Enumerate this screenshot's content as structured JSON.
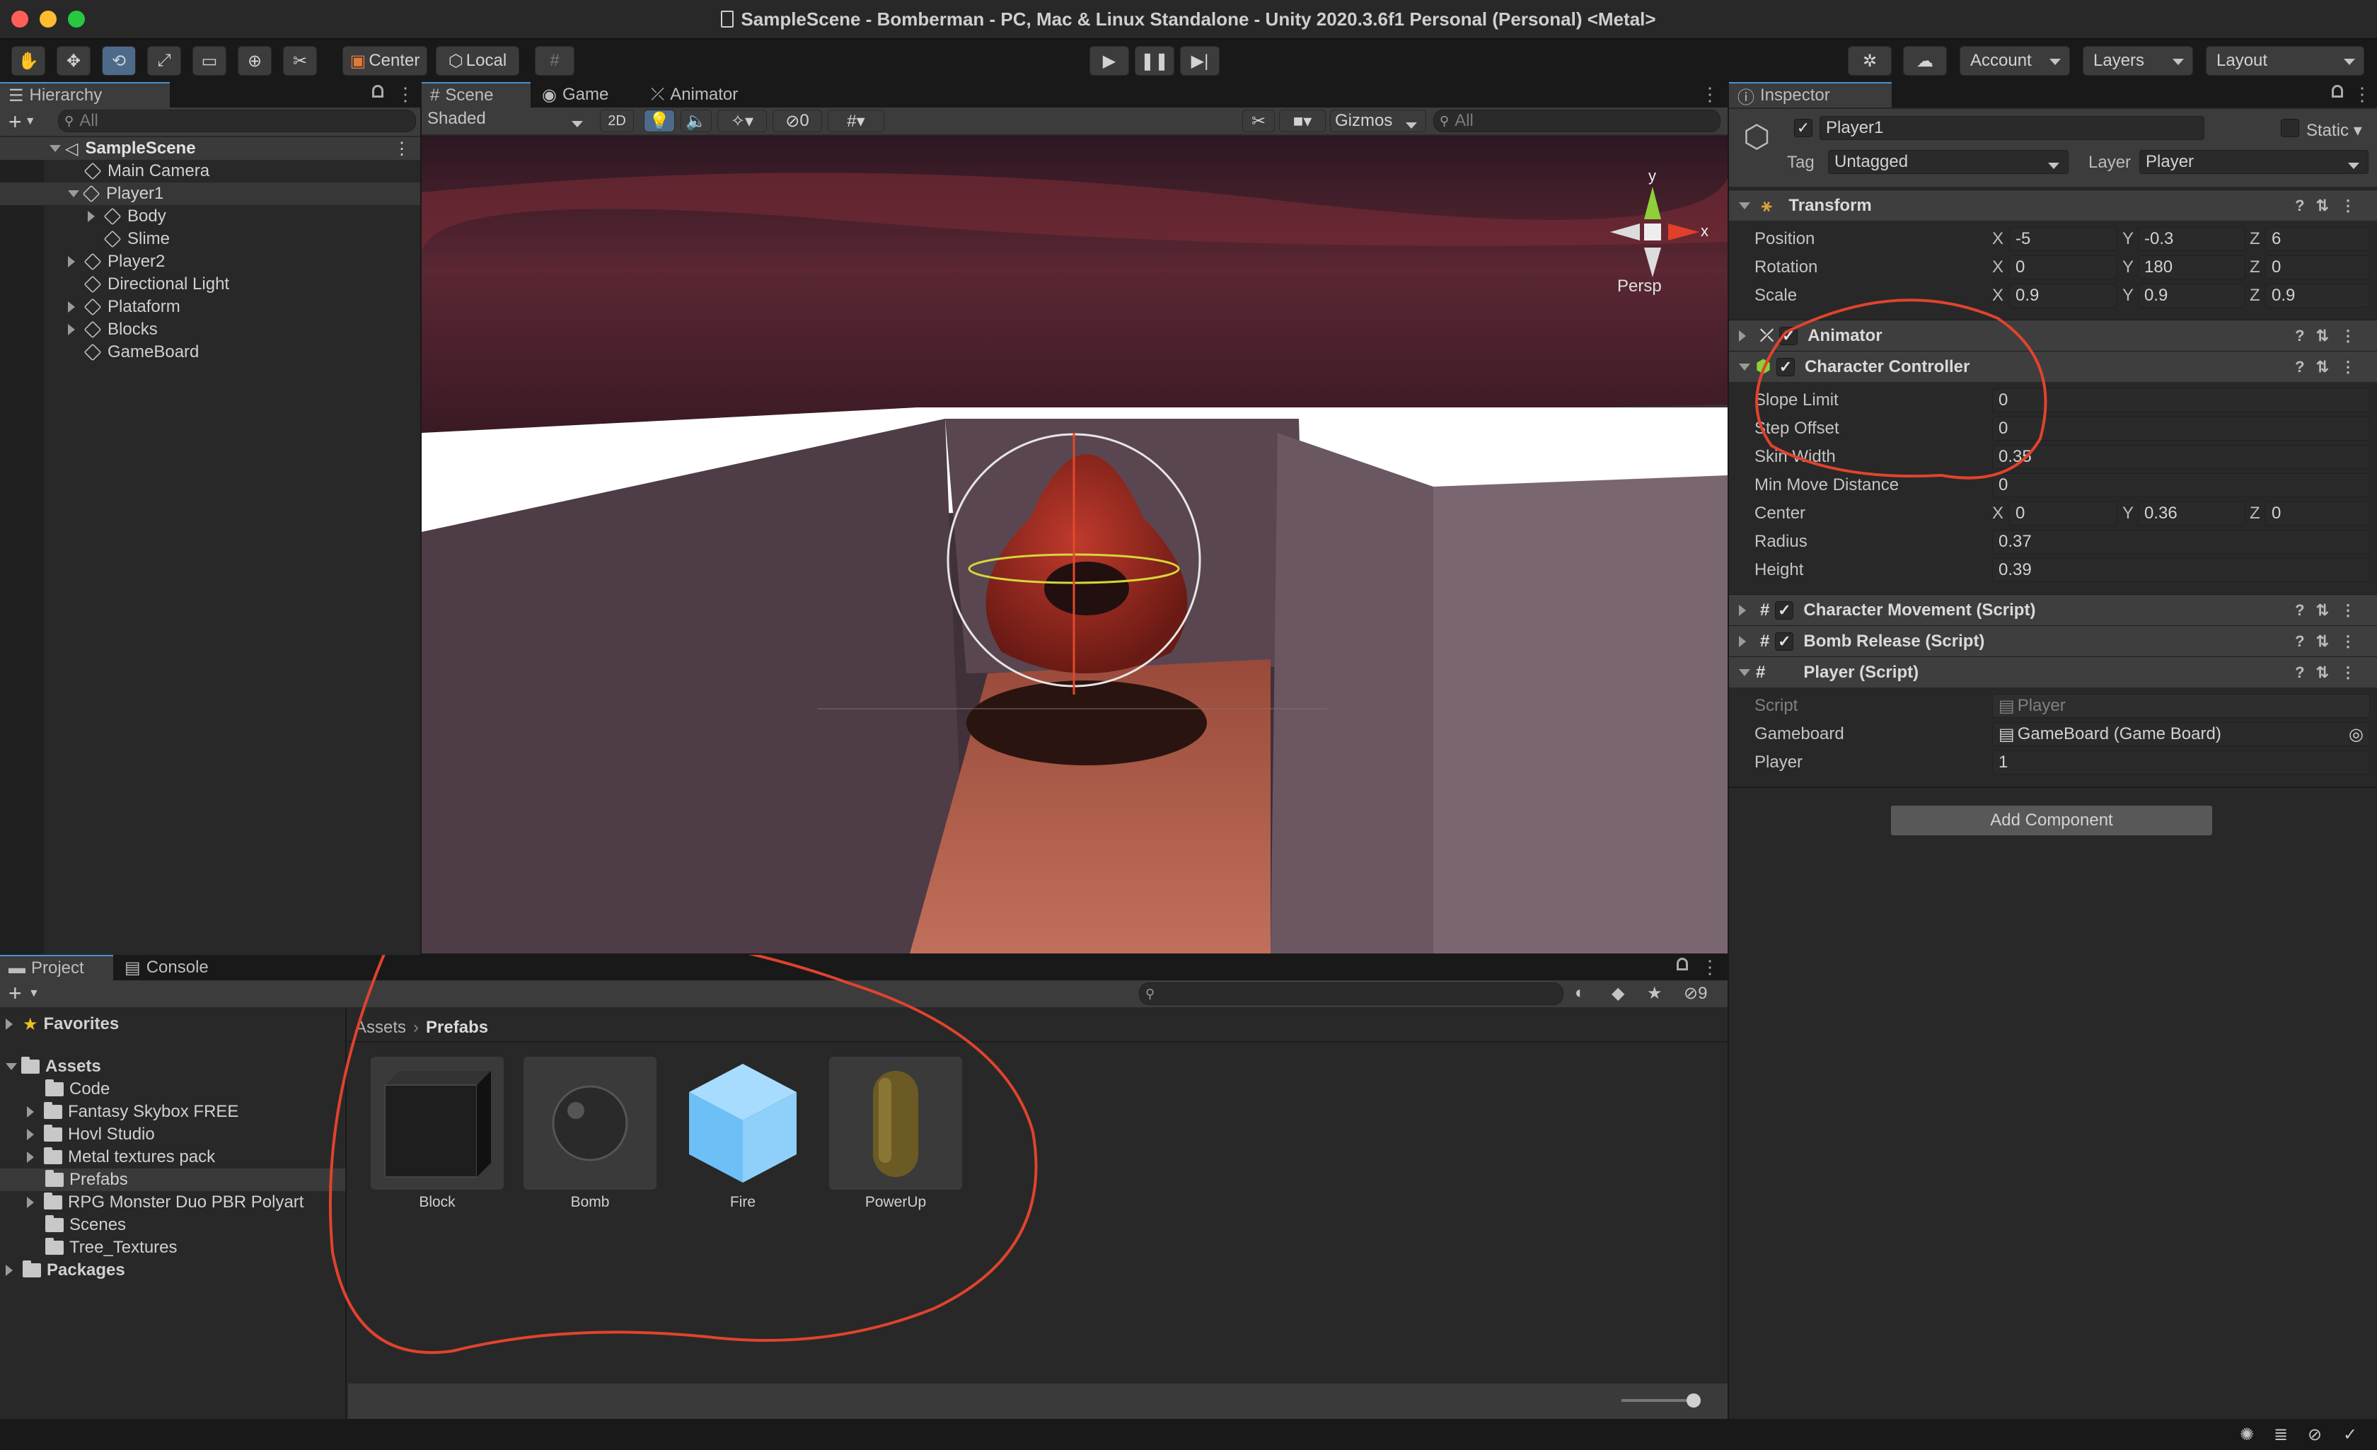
{
  "window": {
    "title": "SampleScene - Bomberman - PC, Mac & Linux Standalone - Unity 2020.3.6f1 Personal (Personal) <Metal>"
  },
  "toolbar": {
    "center_label": "Center",
    "local_label": "Local",
    "account_label": "Account",
    "layers_label": "Layers",
    "layout_label": "Layout"
  },
  "hierarchy": {
    "tab_label": "Hierarchy",
    "search_placeholder": "All",
    "scene": "SampleScene",
    "items": [
      "Main Camera",
      "Player1",
      "Body",
      "Slime",
      "Player2",
      "Directional Light",
      "Plataform",
      "Blocks",
      "GameBoard"
    ]
  },
  "scene_view": {
    "tabs": [
      "Scene",
      "Game",
      "Animator"
    ],
    "shading_mode": "Shaded",
    "mode_2d": "2D",
    "hidden_count": "0",
    "gizmos_label": "Gizmos",
    "search_placeholder": "All",
    "gizmo_axis_y": "y",
    "gizmo_axis_x": "x",
    "projection": "Persp"
  },
  "inspector": {
    "tab_label": "Inspector",
    "object_name": "Player1",
    "static_label": "Static",
    "tag_label": "Tag",
    "tag_value": "Untagged",
    "layer_label": "Layer",
    "layer_value": "Player",
    "transform": {
      "title": "Transform",
      "position_label": "Position",
      "rotation_label": "Rotation",
      "scale_label": "Scale",
      "axis_x": "X",
      "axis_y": "Y",
      "axis_z": "Z",
      "position": {
        "x": "-5",
        "y": "-0.3",
        "z": "6"
      },
      "rotation": {
        "x": "0",
        "y": "180",
        "z": "0"
      },
      "scale": {
        "x": "0.9",
        "y": "0.9",
        "z": "0.9"
      }
    },
    "animator": {
      "title": "Animator"
    },
    "character_controller": {
      "title": "Character Controller",
      "slope_limit_label": "Slope Limit",
      "slope_limit": "0",
      "step_offset_label": "Step Offset",
      "step_offset": "0",
      "skin_width_label": "Skin Width",
      "skin_width": "0.35",
      "min_move_label": "Min Move Distance",
      "min_move": "0",
      "center_label": "Center",
      "center": {
        "x": "0",
        "y": "0.36",
        "z": "0"
      },
      "radius_label": "Radius",
      "radius": "0.37",
      "height_label": "Height",
      "height": "0.39"
    },
    "character_movement": {
      "title": "Character Movement (Script)"
    },
    "bomb_release": {
      "title": "Bomb Release (Script)"
    },
    "player_script": {
      "title": "Player (Script)",
      "script_label": "Script",
      "script_value": "Player",
      "gameboard_label": "Gameboard",
      "gameboard_value": "GameBoard (Game Board)",
      "player_label": "Player",
      "player_value": "1"
    },
    "add_component_label": "Add Component"
  },
  "project": {
    "tabs": [
      "Project",
      "Console"
    ],
    "hidden_count": "9",
    "favorites_label": "Favorites",
    "assets_label": "Assets",
    "folders": [
      "Code",
      "Fantasy Skybox FREE",
      "Hovl Studio",
      "Metal textures pack",
      "Prefabs",
      "RPG Monster Duo PBR Polyart",
      "Scenes",
      "Tree_Textures"
    ],
    "packages_label": "Packages",
    "breadcrumb": [
      "Assets",
      "Prefabs"
    ],
    "assets": [
      "Block",
      "Bomb",
      "Fire",
      "PowerUp"
    ]
  },
  "colors": {
    "accent": "#4d8fd3",
    "annotation": "#e0432e",
    "panel": "#282828"
  }
}
